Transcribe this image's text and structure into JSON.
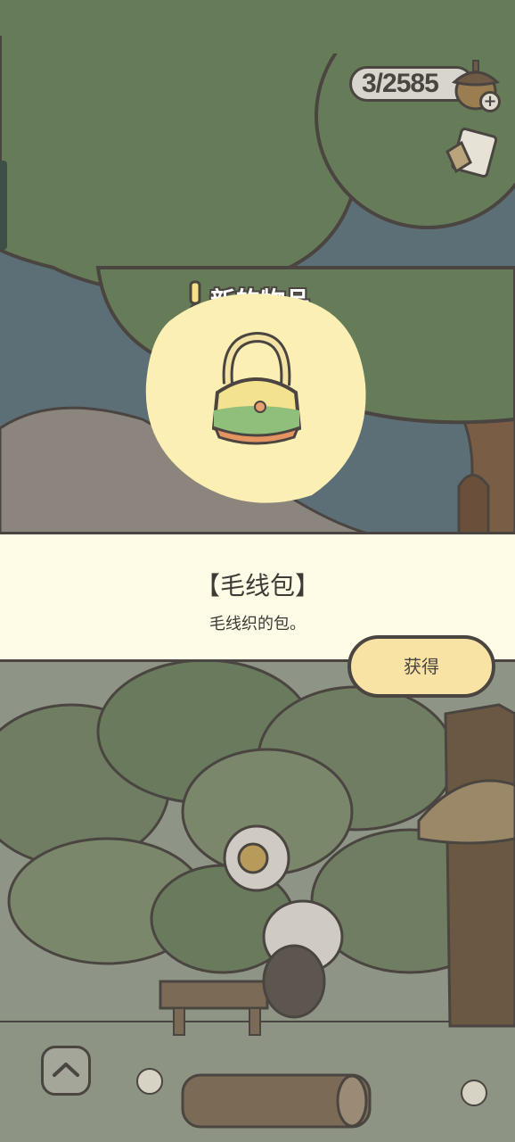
{
  "hud": {
    "currency_value": "3/2585",
    "currency_icon": "acorn-icon",
    "add_icon": "plus-icon",
    "note_icon": "memo-icon"
  },
  "popup": {
    "banner": "新的物品",
    "item_icon": "yarn-bag-icon",
    "item_name": "【毛线包】",
    "item_desc": "毛线织的包。",
    "get_button": "获得"
  },
  "scene": {
    "bubble_icon": "yarn-ball-icon",
    "up_button_icon": "chevron-up-icon"
  },
  "colors": {
    "sky": "#5d6f76",
    "tree": "#667c59",
    "outline": "#4a4540",
    "panel": "#fefbe6",
    "button": "#f8e3a4",
    "blob": "#fbefb4"
  }
}
